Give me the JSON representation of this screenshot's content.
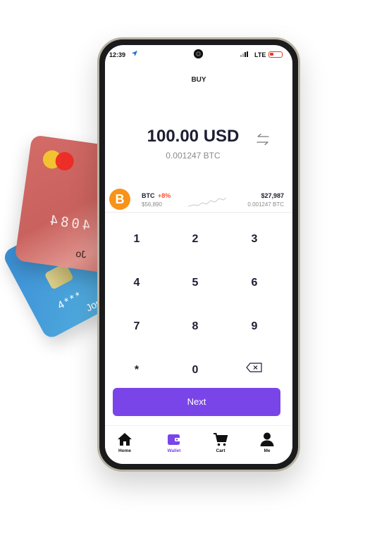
{
  "status_bar": {
    "time": "12:39",
    "network": "LTE"
  },
  "screen_title": "BUY",
  "amount": {
    "primary": "100.00 USD",
    "secondary": "0.001247 BTC"
  },
  "ticker": {
    "symbol": "BTC",
    "change": "+8%",
    "low": "$56,890",
    "price": "$27,987",
    "btc_amount": "0.001247 BTC",
    "logo_glyph": "B"
  },
  "keypad": {
    "keys": [
      "1",
      "2",
      "3",
      "4",
      "5",
      "6",
      "7",
      "8",
      "9",
      "*",
      "0"
    ],
    "backspace_icon": "backspace-icon"
  },
  "next_button": "Next",
  "nav": {
    "items": [
      {
        "label": "Home",
        "icon": "home-icon"
      },
      {
        "label": "Wallet",
        "icon": "wallet-icon"
      },
      {
        "label": "Cart",
        "icon": "cart-icon"
      },
      {
        "label": "Me",
        "icon": "user-icon"
      }
    ],
    "active": "Wallet"
  },
  "cards": {
    "red": {
      "number": "4084",
      "signature": "Jo"
    },
    "blue": {
      "number": "4***",
      "name": "Jonath"
    }
  },
  "colors": {
    "accent": "#7a45e8",
    "positive_change": "#ff4d2d",
    "btc_orange": "#f7931a",
    "battery_low": "#e23a2e"
  }
}
